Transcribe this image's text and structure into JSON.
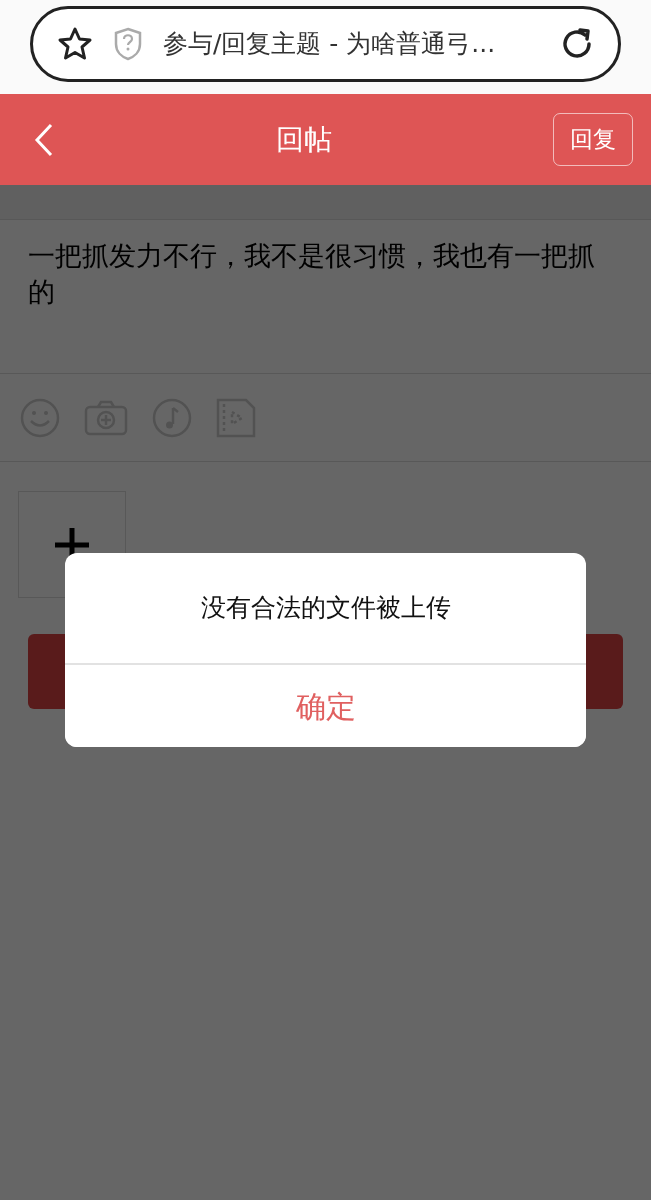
{
  "address_bar": {
    "title": "参与/回复主题 - 为啥普通弓..."
  },
  "header": {
    "title": "回帖",
    "action": "回复"
  },
  "reply": {
    "text": "一把抓发力不行，我不是很习惯，我也有一把抓的"
  },
  "dialog": {
    "message": "没有合法的文件被上传",
    "confirm": "确定"
  }
}
